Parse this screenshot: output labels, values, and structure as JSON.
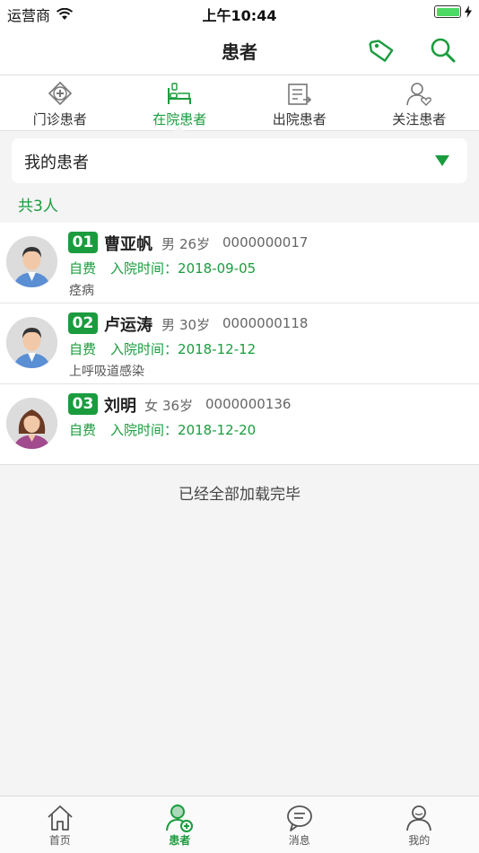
{
  "status_bar": {
    "carrier": "运营商",
    "time": "上午10:44"
  },
  "nav": {
    "title": "患者",
    "tag_icon": "tag-icon",
    "search_icon": "search-icon"
  },
  "tabs": [
    {
      "label": "门诊患者",
      "icon": "outpatient-icon",
      "active": false
    },
    {
      "label": "在院患者",
      "icon": "hospital-bed-icon",
      "active": true
    },
    {
      "label": "出院患者",
      "icon": "discharge-icon",
      "active": false
    },
    {
      "label": "关注患者",
      "icon": "follow-patient-icon",
      "active": false
    }
  ],
  "filter": {
    "selected": "我的患者"
  },
  "summary": {
    "count_text": "共3人"
  },
  "patients": [
    {
      "no": "01",
      "name": "曹亚帆",
      "gender": "男",
      "age": "26岁",
      "id": "0000000017",
      "fee": "自费",
      "admit_label": "入院时间：",
      "admit_date": "2018-09-05",
      "diagnosis": "痉病",
      "avatar": "male"
    },
    {
      "no": "02",
      "name": "卢运涛",
      "gender": "男",
      "age": "30岁",
      "id": "0000000118",
      "fee": "自费",
      "admit_label": "入院时间：",
      "admit_date": "2018-12-12",
      "diagnosis": "上呼吸道感染",
      "avatar": "male"
    },
    {
      "no": "03",
      "name": "刘明",
      "gender": "女",
      "age": "36岁",
      "id": "0000000136",
      "fee": "自费",
      "admit_label": "入院时间：",
      "admit_date": "2018-12-20",
      "diagnosis": "",
      "avatar": "female"
    }
  ],
  "list_footer": "已经全部加载完毕",
  "tabbar": [
    {
      "label": "首页",
      "icon": "home-icon",
      "active": false
    },
    {
      "label": "患者",
      "icon": "patient-icon",
      "active": true
    },
    {
      "label": "消息",
      "icon": "message-icon",
      "active": false
    },
    {
      "label": "我的",
      "icon": "profile-icon",
      "active": false
    }
  ],
  "colors": {
    "accent": "#1a9c3e",
    "background": "#f4f4f4"
  }
}
